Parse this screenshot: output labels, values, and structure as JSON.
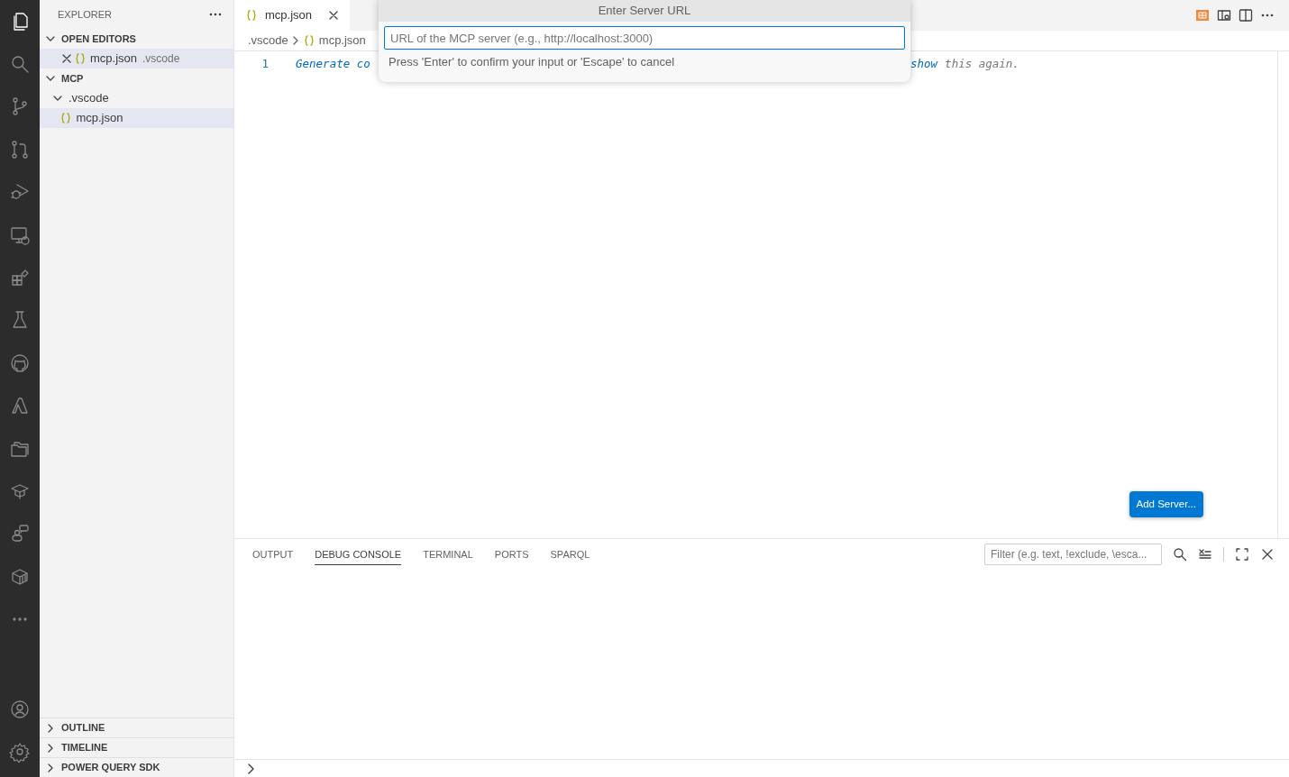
{
  "activity_bar": {
    "top": [
      {
        "kind": "files",
        "selected": true
      },
      {
        "kind": "search",
        "selected": false
      },
      {
        "kind": "branch",
        "selected": false
      },
      {
        "kind": "pull-request",
        "selected": false
      },
      {
        "kind": "run-debug",
        "selected": false
      },
      {
        "kind": "remote",
        "selected": false
      },
      {
        "kind": "extensions",
        "selected": false
      },
      {
        "kind": "flask",
        "selected": false
      },
      {
        "kind": "cat-logo",
        "selected": false
      },
      {
        "kind": "a-logo",
        "selected": false
      },
      {
        "kind": "folders",
        "selected": false
      },
      {
        "kind": "mortarboard",
        "selected": false
      },
      {
        "kind": "chat-robot",
        "selected": false
      },
      {
        "kind": "container",
        "selected": false
      },
      {
        "kind": "more",
        "selected": false
      }
    ],
    "bottom": [
      {
        "kind": "account",
        "selected": false
      },
      {
        "kind": "settings",
        "selected": false
      }
    ]
  },
  "sidebar": {
    "title": "EXPLORER",
    "sections": [
      {
        "title": "OPEN EDITORS",
        "expanded": true,
        "items": [
          {
            "kind": "open-editor",
            "label": "mcp.json",
            "description": ".vscode",
            "selected": true
          }
        ]
      },
      {
        "title": "MCP",
        "expanded": true,
        "items": [
          {
            "kind": "folder",
            "label": ".vscode",
            "expanded": true,
            "selected": false,
            "children": [
              {
                "kind": "file",
                "label": "mcp.json",
                "selected": true
              }
            ]
          }
        ]
      }
    ],
    "bottom_sections": [
      {
        "title": "OUTLINE",
        "expanded": false
      },
      {
        "title": "TIMELINE",
        "expanded": false
      },
      {
        "title": "POWER QUERY SDK",
        "expanded": false
      }
    ]
  },
  "tabs": [
    {
      "label": "mcp.json",
      "selected": true
    }
  ],
  "breadcrumb": [
    {
      "label": ".vscode",
      "kind": "folder"
    },
    {
      "label": "mcp.json",
      "kind": "file"
    }
  ],
  "editor": {
    "lines": [
      {
        "number": "1",
        "left": [
          {
            "text": "Generate co",
            "kind": "link"
          }
        ],
        "right": [
          {
            "text": "show",
            "kind": "link"
          },
          {
            "text": "this again.",
            "kind": "hint"
          }
        ]
      }
    ]
  },
  "quick_input": {
    "title": "Enter Server URL",
    "placeholder": "URL of the MCP server (e.g., http://localhost:3000)",
    "message": "Press 'Enter' to confirm your input or 'Escape' to cancel"
  },
  "floating_button": {
    "label": "Add Server..."
  },
  "panel": {
    "tabs": [
      {
        "label": "OUTPUT",
        "selected": false
      },
      {
        "label": "DEBUG CONSOLE",
        "selected": true
      },
      {
        "label": "TERMINAL",
        "selected": false
      },
      {
        "label": "PORTS",
        "selected": false
      },
      {
        "label": "SPARQL",
        "selected": false
      }
    ],
    "filter": {
      "placeholder": "Filter (e.g. text, !exclude, \\esca..."
    }
  }
}
